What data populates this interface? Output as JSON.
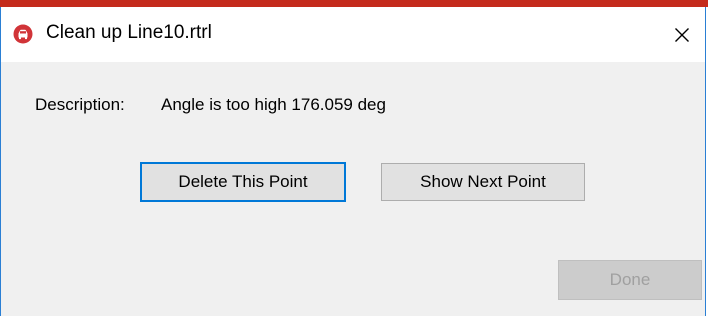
{
  "window": {
    "title": "Clean up Line10.rtrl",
    "icon": "app-red-circle-icon",
    "close_glyph": "✕"
  },
  "description": {
    "label": "Description:",
    "value": "Angle is too high 176.059 deg"
  },
  "buttons": {
    "delete_label": "Delete This Point",
    "show_next_label": "Show Next Point",
    "done_label": "Done"
  },
  "colors": {
    "accent_focus": "#0078d7",
    "titlebar_icon": "#d13438",
    "window_border": "#2a7fd4",
    "top_strip": "#c42b1c"
  }
}
